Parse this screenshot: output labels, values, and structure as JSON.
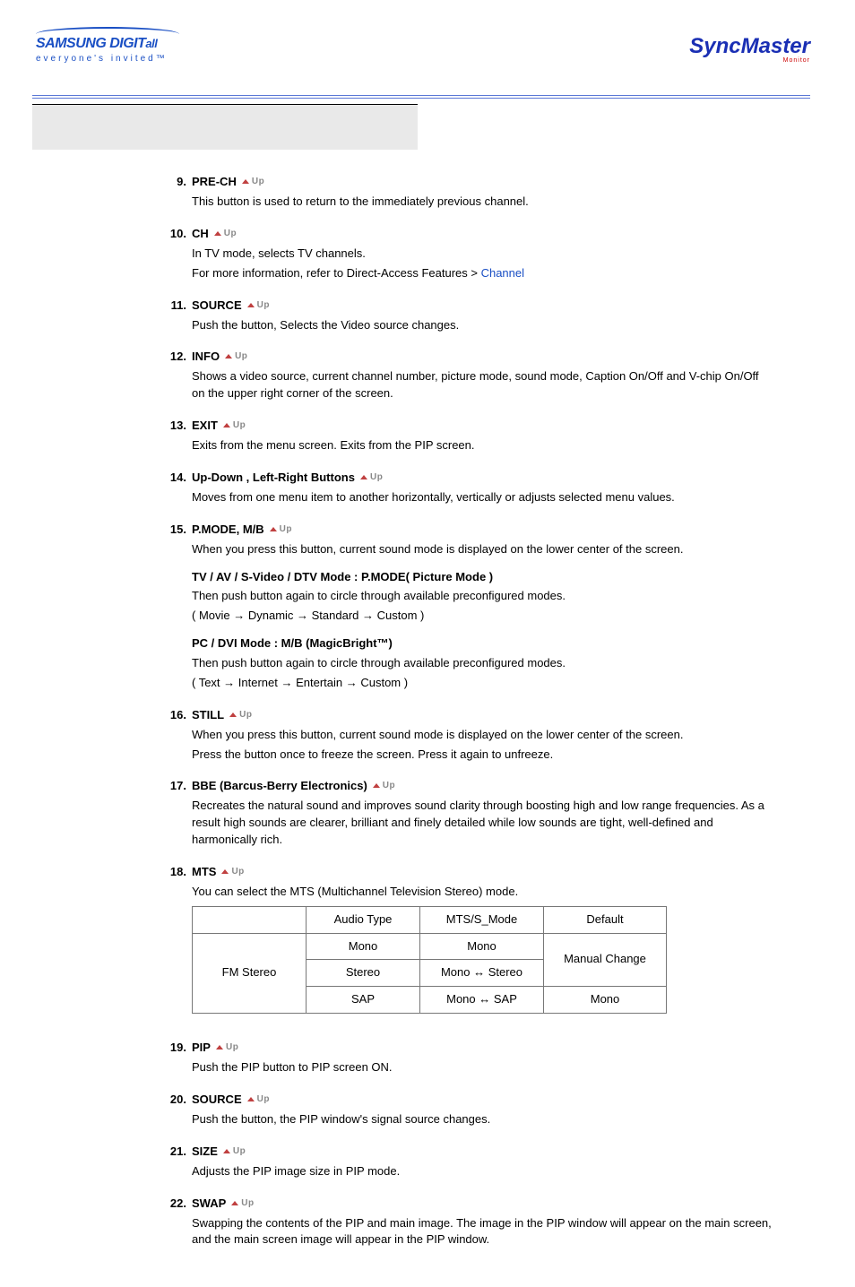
{
  "header": {
    "brand_main": "SAMSUNG DIGIT",
    "brand_suffix": "all",
    "brand_tag": "everyone's invited™",
    "right_brand": "SyncMaster",
    "right_sub": "Monitor"
  },
  "upLabel": "Up",
  "items": {
    "i9": {
      "num": "9.",
      "title": "PRE-CH",
      "body": "This button is used to return to the immediately previous channel."
    },
    "i10": {
      "num": "10.",
      "title": "CH",
      "body1": "In TV mode, selects TV channels.",
      "body2": "For more information, refer to Direct-Access Features > ",
      "link": "Channel"
    },
    "i11": {
      "num": "11.",
      "title": "SOURCE",
      "body": "Push the button, Selects the Video source changes."
    },
    "i12": {
      "num": "12.",
      "title": "INFO",
      "body": "Shows a video source, current channel number, picture mode, sound mode, Caption On/Off and V-chip On/Off on the upper right corner of the screen."
    },
    "i13": {
      "num": "13.",
      "title": "EXIT",
      "body": "Exits from the menu screen. Exits from the PIP screen."
    },
    "i14": {
      "num": "14.",
      "title": "Up-Down , Left-Right Buttons",
      "body": "Moves from one menu item to another horizontally, vertically or adjusts selected menu values."
    },
    "i15": {
      "num": "15.",
      "title": "P.MODE, M/B",
      "intro": "When you press this button, current sound mode is displayed on the lower center of the screen.",
      "sub1_t": "TV / AV / S-Video / DTV Mode : P.MODE( Picture Mode )",
      "sub1_b": "Then push button again to circle through available preconfigured modes.",
      "sub1_seq": "( Movie  →  Dynamic  →  Standard  →  Custom )",
      "sub2_t": "PC / DVI Mode : M/B (MagicBright™)",
      "sub2_b": "Then push button again to circle through available preconfigured modes.",
      "sub2_seq": "( Text  →  Internet  →  Entertain  →  Custom )"
    },
    "i16": {
      "num": "16.",
      "title": "STILL",
      "body1": "When you press this button, current sound mode is displayed on the lower center of the screen.",
      "body2": "Press the button once to freeze the screen. Press it again to unfreeze."
    },
    "i17": {
      "num": "17.",
      "title": "BBE (Barcus-Berry Electronics)",
      "body": "Recreates the natural sound and improves sound clarity through boosting high and low range frequencies. As a result high sounds are clearer, brilliant and finely detailed while low sounds are tight, well-defined and harmonically rich."
    },
    "i18": {
      "num": "18.",
      "title": "MTS",
      "body": "You can select the MTS (Multichannel Television Stereo) mode.",
      "th1": "",
      "th2": "Audio Type",
      "th3": "MTS/S_Mode",
      "th4": "Default",
      "r1c1": "FM Stereo",
      "r1_at": "Mono",
      "r1_m": "Mono",
      "r1_d": "Manual Change",
      "r2_at": "Stereo",
      "r2_m": "Mono  ↔  Stereo",
      "r3_at": "SAP",
      "r3_m": "Mono  ↔  SAP",
      "r3_d": "Mono"
    },
    "i19": {
      "num": "19.",
      "title": "PIP",
      "body": "Push the PIP button to PIP screen ON."
    },
    "i20": {
      "num": "20.",
      "title": "SOURCE",
      "body": "Push the button, the PIP window's signal source changes."
    },
    "i21": {
      "num": "21.",
      "title": "SIZE",
      "body": "Adjusts the PIP image size in PIP mode."
    },
    "i22": {
      "num": "22.",
      "title": "SWAP",
      "body": "Swapping the contents of the PIP and main image. The image in the PIP window will appear on the main screen, and the main screen image will appear in the PIP window."
    }
  }
}
